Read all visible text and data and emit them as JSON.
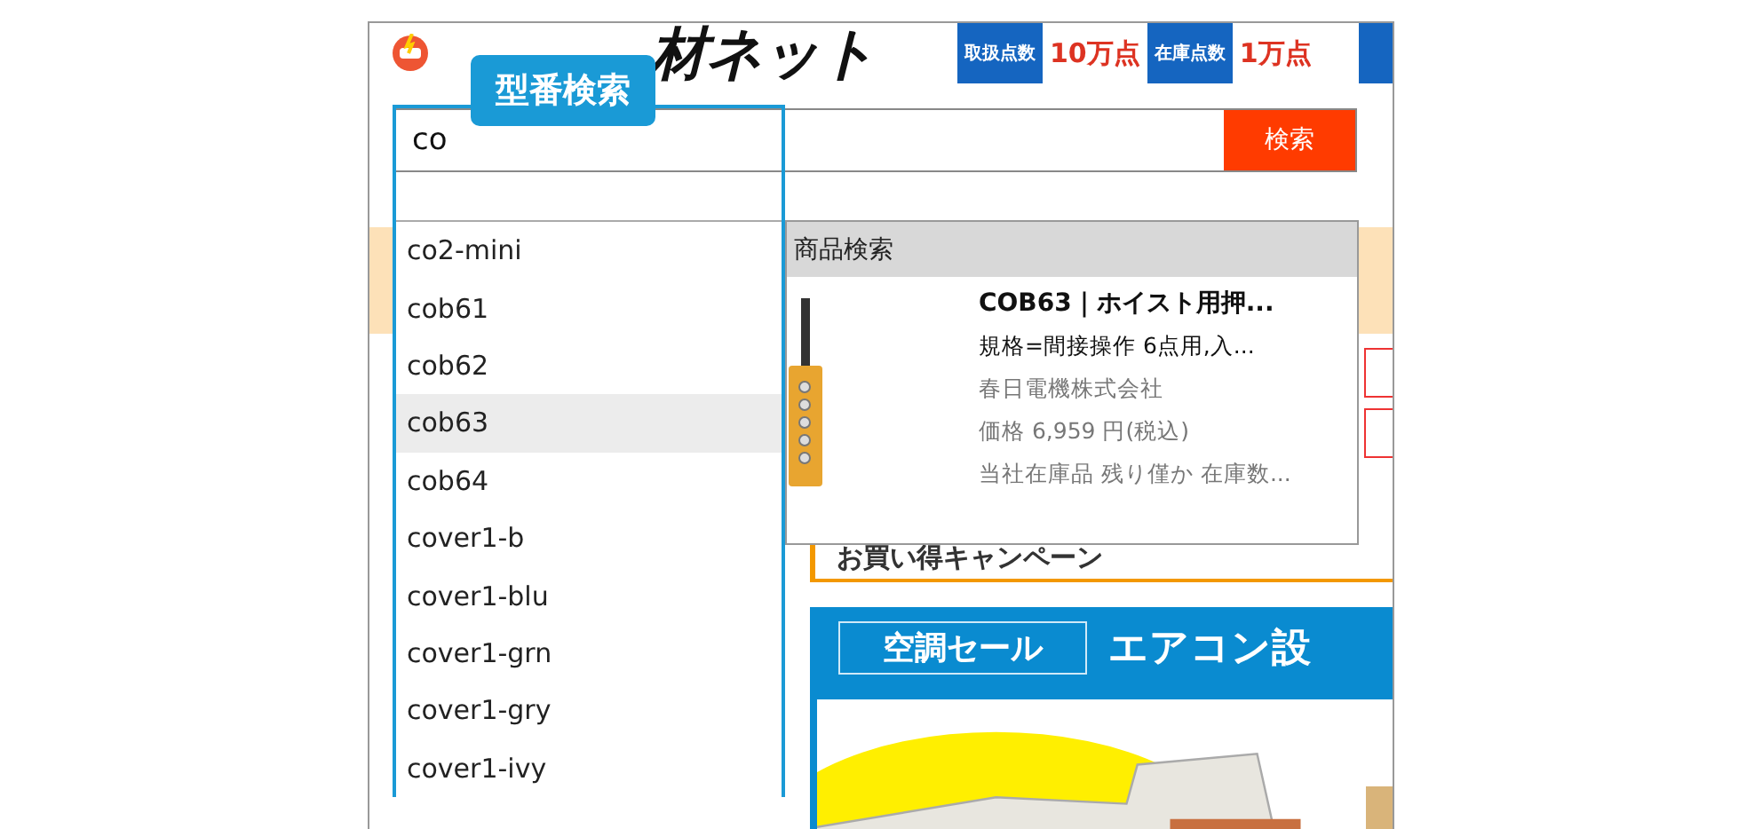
{
  "header": {
    "logo_text": "材ネット",
    "stats": [
      {
        "label": "取扱点数",
        "value": "10万点"
      },
      {
        "label": "在庫点数",
        "value": "1万点"
      }
    ]
  },
  "badge": "型番検索",
  "search": {
    "value": "co",
    "button": "検索"
  },
  "suggestions": [
    {
      "text": "co2-mini",
      "selected": false
    },
    {
      "text": "cob61",
      "selected": false
    },
    {
      "text": "cob62",
      "selected": false
    },
    {
      "text": "cob63",
      "selected": true
    },
    {
      "text": "cob64",
      "selected": false
    },
    {
      "text": "cover1-b",
      "selected": false
    },
    {
      "text": "cover1-blu",
      "selected": false
    },
    {
      "text": "cover1-grn",
      "selected": false
    },
    {
      "text": "cover1-gry",
      "selected": false
    },
    {
      "text": "cover1-ivy",
      "selected": false
    }
  ],
  "product_panel": {
    "title": "商品検索",
    "name": "COB63｜ホイスト用押...",
    "spec": "規格=間接操作 6点用,入...",
    "maker": "春日電機株式会社",
    "price": "価格 6,959 円(税込)",
    "stock": "当社在庫品 残り僅か 在庫数..."
  },
  "campaign": "お買い得キャンペーン",
  "banner": {
    "tag": "空調セール",
    "title": "エアコン設"
  }
}
